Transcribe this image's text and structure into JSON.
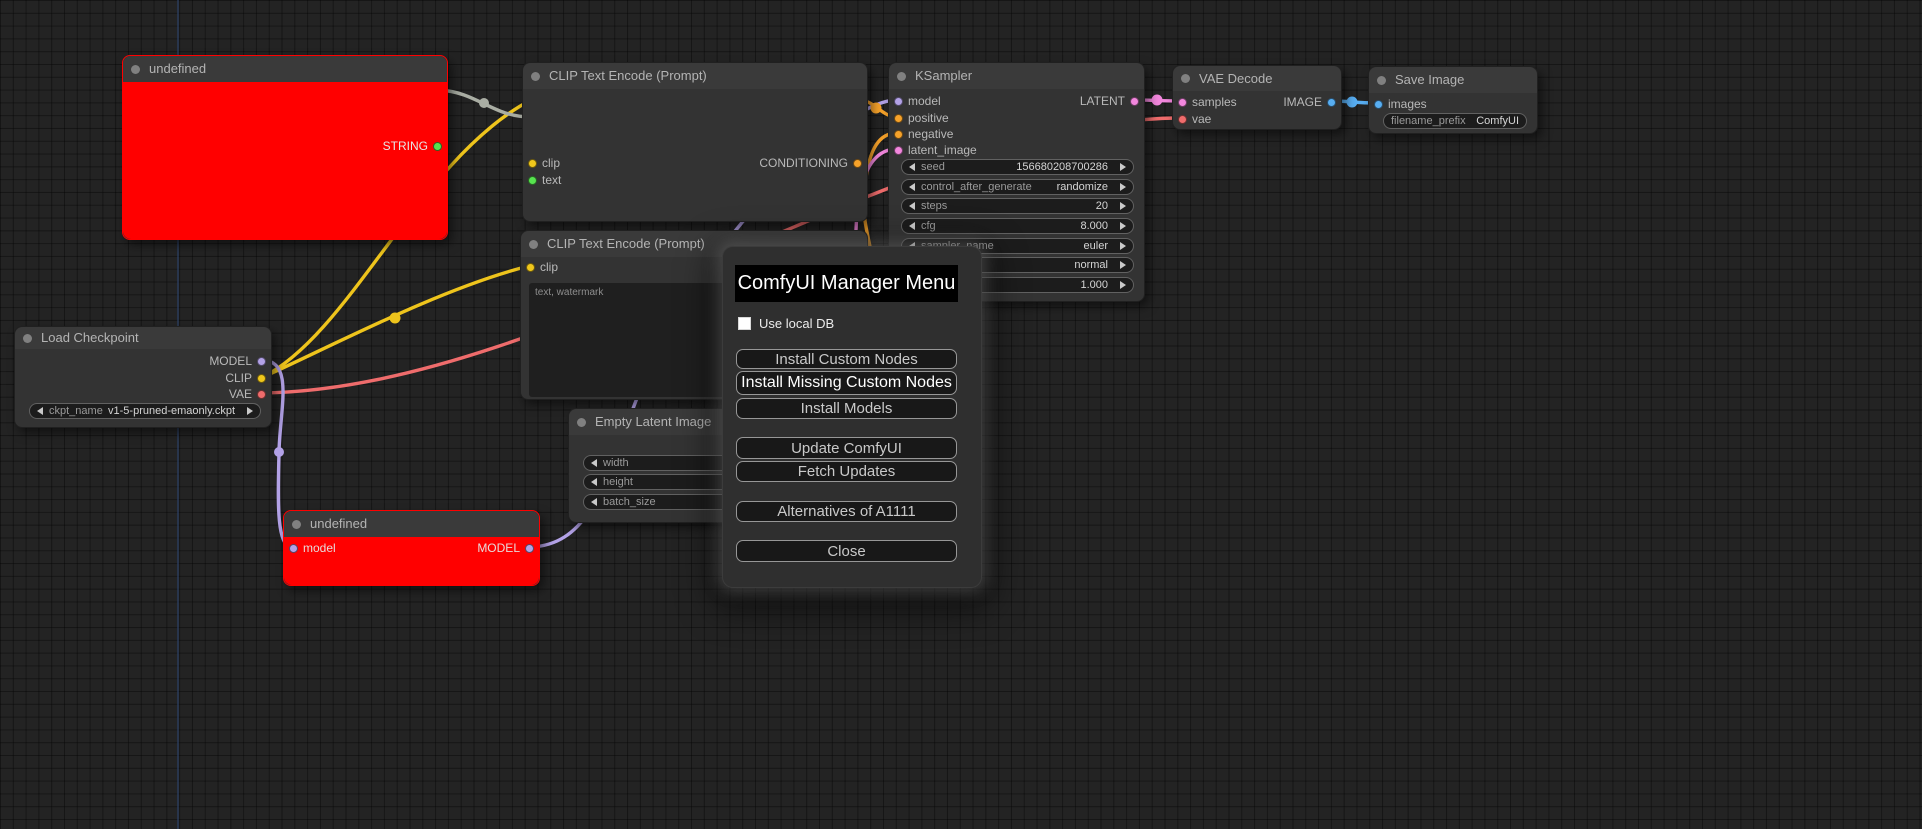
{
  "colors": {
    "wire": {
      "clip": "#eec41c",
      "string_link": "#a9ada3",
      "vae": "#ef6c6c",
      "model": "#b3a2e7",
      "conditioning": "#f6a22a",
      "latent": "#f287dd",
      "image": "#58aef2",
      "faint_line": "#2b3f63"
    },
    "slot": {
      "string": "#57e34f",
      "clip": "#f0c71c",
      "text": "#57e34f",
      "conditioning": "#f6a22a",
      "model": "#b3a2e7",
      "latent": "#f287dd",
      "vae": "#ef6c6c",
      "image": "#58aef2",
      "header_dot": "#808080"
    }
  },
  "nodes": {
    "string_node": {
      "title": "undefined",
      "output": "STRING"
    },
    "clip_text_encode_top": {
      "title": "CLIP Text Encode (Prompt)",
      "input_clip": "clip",
      "input_text": "text",
      "output": "CONDITIONING"
    },
    "clip_text_encode_bottom": {
      "title": "CLIP Text Encode (Prompt)",
      "input_clip": "clip",
      "prompt_text": "text, watermark"
    },
    "load_checkpoint": {
      "title": "Load Checkpoint",
      "output_model": "MODEL",
      "output_clip": "CLIP",
      "output_vae": "VAE",
      "widget": {
        "label": "ckpt_name",
        "value": "v1-5-pruned-emaonly.ckpt"
      }
    },
    "empty_latent_image": {
      "title": "Empty Latent Image",
      "widgets": [
        {
          "label": "width"
        },
        {
          "label": "height"
        },
        {
          "label": "batch_size"
        }
      ]
    },
    "ksampler": {
      "title": "KSampler",
      "inputs": [
        "model",
        "positive",
        "negative",
        "latent_image"
      ],
      "output": "LATENT",
      "widgets": [
        {
          "label": "seed",
          "value": "156680208700286"
        },
        {
          "label": "control_after_generate",
          "value": "randomize"
        },
        {
          "label": "steps",
          "value": "20"
        },
        {
          "label": "cfg",
          "value": "8.000"
        },
        {
          "label": "sampler_name",
          "value": "euler"
        },
        {
          "label": "",
          "value": "normal"
        },
        {
          "label": "",
          "value": "1.000"
        }
      ]
    },
    "vae_decode": {
      "title": "VAE Decode",
      "input_samples": "samples",
      "input_vae": "vae",
      "output": "IMAGE"
    },
    "save_image": {
      "title": "Save Image",
      "input": "images",
      "widget": {
        "label": "filename_prefix",
        "value": "ComfyUI"
      }
    },
    "model_node": {
      "title": "undefined",
      "input": "model",
      "output": "MODEL"
    }
  },
  "dialog": {
    "title": "ComfyUI Manager Menu",
    "use_local_db": {
      "label": "Use local DB",
      "checked": false
    },
    "buttons": [
      "Install Custom Nodes",
      "Install Missing Custom Nodes",
      "Install Models",
      "Update ComfyUI",
      "Fetch Updates",
      "Alternatives of A1111",
      "Close"
    ]
  }
}
